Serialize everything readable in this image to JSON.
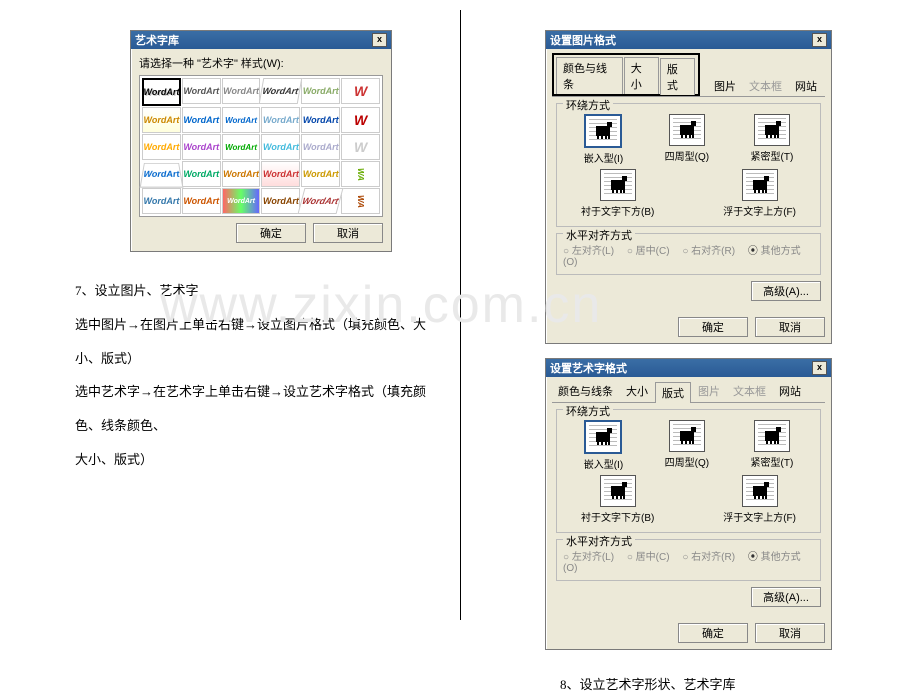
{
  "watermark": "www.zixin.com.cn",
  "left": {
    "wordart_dialog": {
      "title": "艺术字库",
      "prompt": "请选择一种 \"艺术字\" 样式(W):",
      "cell_text": "WordArt",
      "ok": "确定",
      "cancel": "取消",
      "close": "x"
    },
    "section_number": "7、",
    "section_title": "设立图片、艺术字",
    "line1": "选中图片→在图片上单击右键→设立图片格式（填充颜色、大小、版式）",
    "line2": "选中艺术字→在艺术字上单击右键→设立艺术字格式（填充颜色、线条颜色、",
    "line3": "大小、版式）"
  },
  "right": {
    "fmt_pic": {
      "title": "设置图片格式",
      "tabs": {
        "color": "颜色与线条",
        "size": "大小",
        "layout": "版式",
        "picture": "图片",
        "textbox": "文本框",
        "web": "网站"
      },
      "group_wrap": "环绕方式",
      "wrap": {
        "inline": "嵌入型(I)",
        "square": "四周型(Q)",
        "tight": "紧密型(T)",
        "behind": "衬于文字下方(B)",
        "front": "浮于文字上方(F)"
      },
      "group_align": "水平对齐方式",
      "align": {
        "left": "左对齐(L)",
        "center": "居中(C)",
        "right": "右对齐(R)",
        "other": "其他方式(O)"
      },
      "advanced": "高级(A)...",
      "ok": "确定",
      "cancel": "取消",
      "close": "x"
    },
    "fmt_wa": {
      "title": "设置艺术字格式"
    },
    "section8_number": "8、",
    "section8_title": "设立艺术字形状、艺术字库"
  }
}
